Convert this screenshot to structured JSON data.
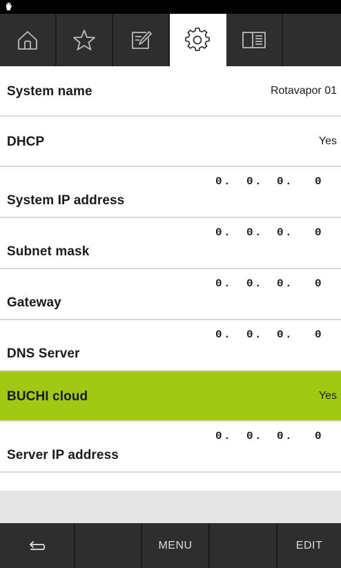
{
  "colors": {
    "highlight": "#a1c913",
    "tabbar_bg": "#2e2e2e",
    "active_tab_bg": "#ffffff",
    "gray_area": "#e5e5e5"
  },
  "status_bar": {
    "icon": "hand-icon"
  },
  "tabs": [
    {
      "icon": "home-icon",
      "active": false
    },
    {
      "icon": "star-icon",
      "active": false
    },
    {
      "icon": "edit-icon",
      "active": false
    },
    {
      "icon": "gear-icon",
      "active": true
    },
    {
      "icon": "book-icon",
      "active": false
    }
  ],
  "settings": {
    "system_name": {
      "label": "System name",
      "value": "Rotavapor 01"
    },
    "dhcp": {
      "label": "DHCP",
      "value": "Yes"
    },
    "system_ip": {
      "label": "System IP address",
      "octets": [
        "0",
        "0",
        "0",
        "0"
      ],
      "sep": "."
    },
    "subnet_mask": {
      "label": "Subnet mask",
      "octets": [
        "0",
        "0",
        "0",
        "0"
      ],
      "sep": "."
    },
    "gateway": {
      "label": "Gateway",
      "octets": [
        "0",
        "0",
        "0",
        "0"
      ],
      "sep": "."
    },
    "dns_server": {
      "label": "DNS Server",
      "octets": [
        "0",
        "0",
        "0",
        "0"
      ],
      "sep": "."
    },
    "buchi_cloud": {
      "label": "BUCHI cloud",
      "value": "Yes",
      "selected": true
    },
    "server_ip": {
      "label": "Server IP address",
      "octets": [
        "0",
        "0",
        "0",
        "0"
      ],
      "sep": "."
    }
  },
  "softkeys": {
    "back_icon": "back-arrow-icon",
    "menu_label": "MENU",
    "edit_label": "EDIT"
  }
}
